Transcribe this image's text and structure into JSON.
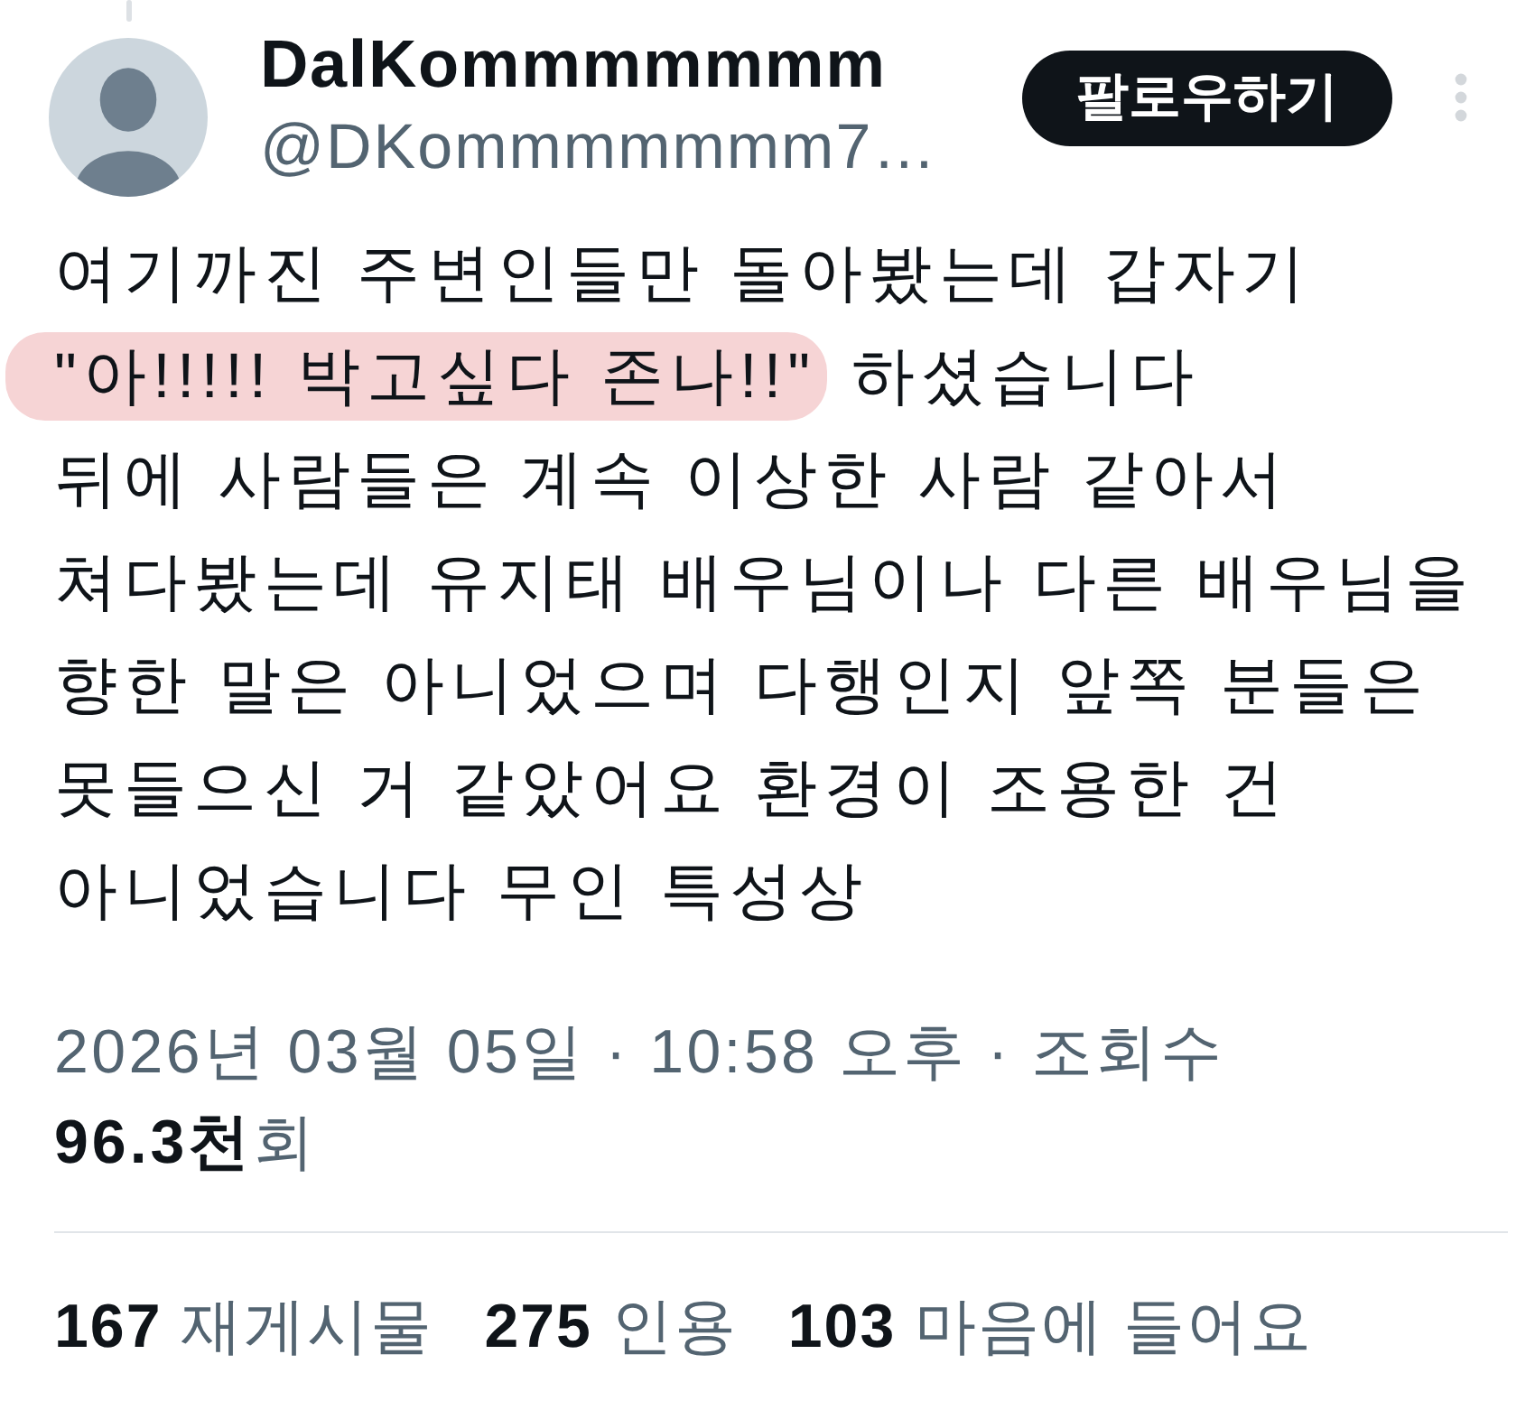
{
  "author": {
    "name": "DalKommmmmmm",
    "handle": "@DKommmmmmm7…"
  },
  "follow_button": {
    "label": "팔로우하기"
  },
  "body": {
    "segments": [
      {
        "text": "여기까진 주변인들만 돌아봤는데 갑자기\n",
        "highlighted": false
      },
      {
        "text": "\"아!!!!! 박고싶다 존나!!\"",
        "highlighted": true
      },
      {
        "text": " 하셨습니다\n뒤에 사람들은 계속 이상한 사람 같아서\n쳐다봤는데 유지태 배우님이나 다른 배우님을\n향한 말은 아니었으며 다행인지 앞쪽 분들은\n못들으신 거 같았어요 환경이 조용한 건\n아니었습니다 무인 특성상",
        "highlighted": false
      }
    ]
  },
  "timestamp": "2026년 03월 05일 · 10:58 오후 · 조회수",
  "views": "**96.3천**회",
  "stats": [
    {
      "text": "**167** 재게시물"
    },
    {
      "text": "**275** 인용"
    },
    {
      "text": "**103** 마음에 들어요"
    }
  ]
}
